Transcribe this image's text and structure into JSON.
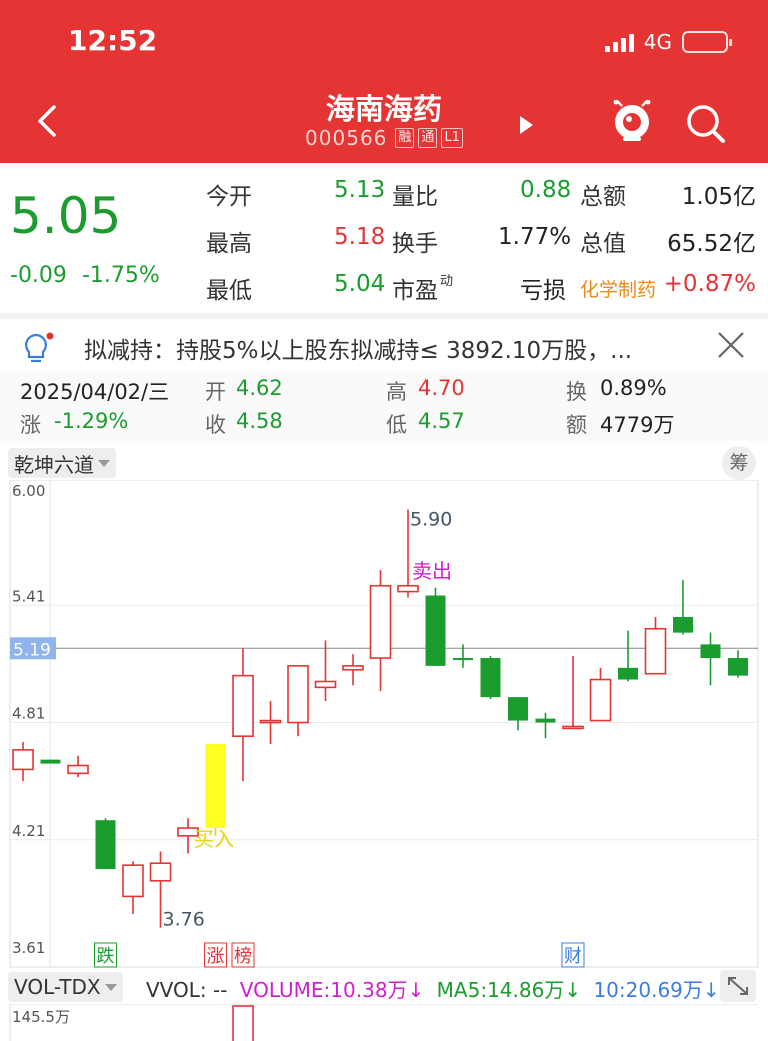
{
  "status_bar": {
    "time": "12:52",
    "network": "4G"
  },
  "header": {
    "title": "海南海药",
    "code": "000566",
    "tags": [
      "融",
      "通",
      "L1"
    ]
  },
  "quote": {
    "price": "5.05",
    "change": "-0.09",
    "change_pct": "-1.75%",
    "rows": [
      {
        "l1": "今开",
        "v1": "5.13",
        "l2": "量比",
        "v2": "0.88",
        "l3": "总额",
        "v3": "1.05亿"
      },
      {
        "l1": "最高",
        "v1": "5.18",
        "l2": "换手",
        "v2": "1.77%",
        "l3": "总值",
        "v3": "65.52亿"
      },
      {
        "l1": "最低",
        "v1": "5.04",
        "l2": "市盈",
        "l2_sup": "动",
        "v2": "亏损",
        "l3": "化学制药",
        "v3": "+0.87%"
      }
    ]
  },
  "notice": {
    "text": "拟减持：持股5%以上股东拟减持≤ 3892.10万股，..."
  },
  "ohlc": {
    "date": "2025/04/02/三",
    "open_label": "开",
    "open": "4.62",
    "high_label": "高",
    "high": "4.70",
    "turnover_label": "换",
    "turnover": "0.89%",
    "change_label": "涨",
    "change": "-1.29%",
    "close_label": "收",
    "close": "4.58",
    "low_label": "低",
    "low": "4.57",
    "amount_label": "额",
    "amount": "4779万"
  },
  "indicator": {
    "name": "乾坤六道",
    "chou": "筹"
  },
  "chart_data": {
    "type": "candlestick",
    "y_ticks": [
      "6.00",
      "5.41",
      "4.81",
      "4.21",
      "3.61"
    ],
    "ylim": [
      3.61,
      6.0
    ],
    "current_price_label": "5.19",
    "current_price": 5.19,
    "annotations": {
      "high": "5.90",
      "low": "3.76",
      "sell": "卖出",
      "buy": "买入",
      "markers": [
        {
          "text": "跌",
          "color": "#1a9d2e",
          "index": 3
        },
        {
          "text": "涨",
          "color": "#e53434",
          "index": 7
        },
        {
          "text": "榜",
          "color": "#e53434",
          "index": 8
        },
        {
          "text": "财",
          "color": "#3a7de0",
          "index": 20
        }
      ]
    },
    "candles": [
      {
        "o": 4.57,
        "h": 4.71,
        "l": 4.51,
        "c": 4.67,
        "col": "up"
      },
      {
        "o": 4.62,
        "h": 4.62,
        "l": 4.6,
        "c": 4.6,
        "col": "down"
      },
      {
        "o": 4.55,
        "h": 4.64,
        "l": 4.53,
        "c": 4.59,
        "col": "up"
      },
      {
        "o": 4.31,
        "h": 4.32,
        "l": 4.06,
        "c": 4.06,
        "col": "down"
      },
      {
        "o": 3.92,
        "h": 4.1,
        "l": 3.83,
        "c": 4.08,
        "col": "up"
      },
      {
        "o": 4.0,
        "h": 4.15,
        "l": 3.76,
        "c": 4.09,
        "col": "up"
      },
      {
        "o": 4.23,
        "h": 4.32,
        "l": 4.14,
        "c": 4.27,
        "col": "up"
      },
      {
        "o": 4.27,
        "h": 4.7,
        "l": 4.23,
        "c": 4.7,
        "col": "limit"
      },
      {
        "o": 4.74,
        "h": 5.19,
        "l": 4.51,
        "c": 5.05,
        "col": "up"
      },
      {
        "o": 4.81,
        "h": 4.92,
        "l": 4.7,
        "c": 4.82,
        "col": "up"
      },
      {
        "o": 4.81,
        "h": 5.1,
        "l": 4.74,
        "c": 5.1,
        "col": "up"
      },
      {
        "o": 4.99,
        "h": 5.23,
        "l": 4.92,
        "c": 5.02,
        "col": "up"
      },
      {
        "o": 5.08,
        "h": 5.16,
        "l": 5.0,
        "c": 5.1,
        "col": "up"
      },
      {
        "o": 5.14,
        "h": 5.59,
        "l": 4.97,
        "c": 5.51,
        "col": "up"
      },
      {
        "o": 5.48,
        "h": 5.9,
        "l": 5.45,
        "c": 5.51,
        "col": "up"
      },
      {
        "o": 5.46,
        "h": 5.5,
        "l": 5.1,
        "c": 5.1,
        "col": "down"
      },
      {
        "o": 5.14,
        "h": 5.21,
        "l": 5.09,
        "c": 5.13,
        "col": "down"
      },
      {
        "o": 5.14,
        "h": 5.15,
        "l": 4.93,
        "c": 4.94,
        "col": "down"
      },
      {
        "o": 4.94,
        "h": 4.94,
        "l": 4.77,
        "c": 4.82,
        "col": "down"
      },
      {
        "o": 4.83,
        "h": 4.86,
        "l": 4.73,
        "c": 4.81,
        "col": "down"
      },
      {
        "o": 4.78,
        "h": 5.15,
        "l": 4.78,
        "c": 4.79,
        "col": "up"
      },
      {
        "o": 4.82,
        "h": 5.09,
        "l": 4.82,
        "c": 5.03,
        "col": "up"
      },
      {
        "o": 5.09,
        "h": 5.28,
        "l": 5.02,
        "c": 5.03,
        "col": "down"
      },
      {
        "o": 5.06,
        "h": 5.35,
        "l": 5.06,
        "c": 5.29,
        "col": "up"
      },
      {
        "o": 5.35,
        "h": 5.54,
        "l": 5.26,
        "c": 5.27,
        "col": "down"
      },
      {
        "o": 5.21,
        "h": 5.27,
        "l": 5.0,
        "c": 5.14,
        "col": "down"
      },
      {
        "o": 5.14,
        "h": 5.18,
        "l": 5.04,
        "c": 5.05,
        "col": "down"
      }
    ]
  },
  "volume": {
    "indicator": "VOL-TDX",
    "vvol": "VVOL: --",
    "volume": "VOLUME:10.38万↓",
    "ma5": "MA5:14.86万↓",
    "ma10": "10:20.69万↓",
    "axis_max": "145.5万"
  },
  "colors": {
    "up": "#e53434",
    "down": "#1a9d2e",
    "limit": "#ffff22",
    "accent": "#e53434"
  }
}
